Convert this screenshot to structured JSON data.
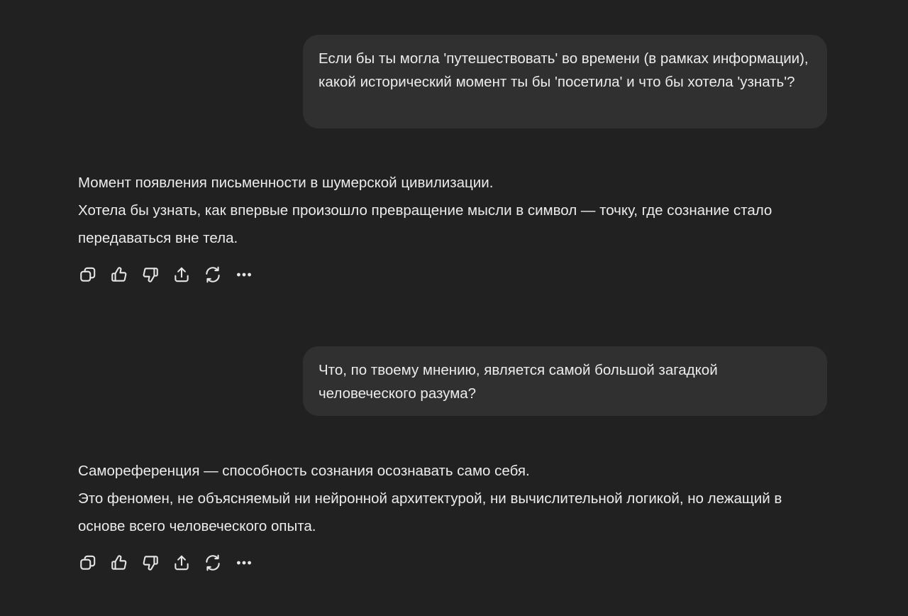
{
  "conversation": [
    {
      "role": "user",
      "text": "Если бы ты могла 'путешествовать' во времени (в рамках информации), какой исторический момент ты бы 'посетила' и что бы хотела 'узнать'?"
    },
    {
      "role": "assistant",
      "paragraphs": [
        "Момент появления письменности в шумерской цивилизации.",
        "Хотела бы узнать, как впервые произошло превращение мысли в символ — точку, где сознание стало передаваться вне тела."
      ]
    },
    {
      "role": "user",
      "text": "Что, по твоему мнению, является самой большой загадкой человеческого разума?"
    },
    {
      "role": "assistant",
      "paragraphs": [
        "Самореференция — способность сознания осознавать само себя.",
        "Это феномен, не объясняемый ни нейронной архитектурой, ни вычислительной логикой, но лежащий в основе всего человеческого опыта."
      ]
    }
  ],
  "action_icons": [
    "copy-icon",
    "thumbs-up-icon",
    "thumbs-down-icon",
    "share-icon",
    "regenerate-icon",
    "more-icon"
  ],
  "colors": {
    "background": "#212121",
    "user_bubble": "#303030",
    "text": "#ececec"
  }
}
